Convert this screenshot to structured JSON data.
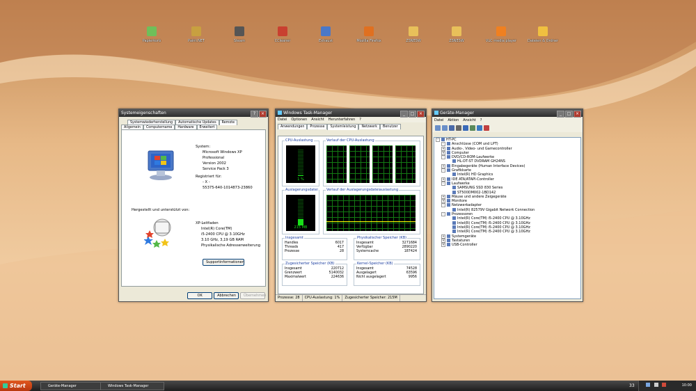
{
  "desktop_icons": [
    {
      "label": "Papierkorb",
      "icon": "recycle-bin-icon",
      "color": "#6fbf5a"
    },
    {
      "label": "Paint.NET",
      "icon": "paint-icon",
      "color": "#c8a040"
    },
    {
      "label": "Steam",
      "icon": "steam-icon",
      "color": "#555555"
    },
    {
      "label": "CCleaner",
      "icon": "ccleaner-icon",
      "color": "#c94030"
    },
    {
      "label": "Exhaust",
      "icon": "exhaust-icon",
      "color": "#4a78c8"
    },
    {
      "label": "Mozilla Firefox",
      "icon": "firefox-icon",
      "color": "#e07020"
    },
    {
      "label": "ZSNESW",
      "icon": "zsnes-icon",
      "color": "#e8c05a"
    },
    {
      "label": "ZSNESW",
      "icon": "zsnes-icon",
      "color": "#e8c05a"
    },
    {
      "label": "VLC media player",
      "icon": "vlc-icon",
      "color": "#f08020"
    },
    {
      "label": "Dateien & Ordner",
      "icon": "folder-icon",
      "color": "#f0c040"
    }
  ],
  "sysprops": {
    "title": "Systemeigenschaften",
    "tabs_top": [
      "Systemwiederherstellung",
      "Automatische Updates",
      "Remote"
    ],
    "tabs_bottom": [
      "Allgemein",
      "Computername",
      "Hardware",
      "Erweitert"
    ],
    "system_heading": "System:",
    "system_lines": [
      "Microsoft Windows XP",
      "Professional",
      "Version 2002",
      "Service Pack 3"
    ],
    "registered_heading": "Registriert für:",
    "registered_lines": [
      "- X -",
      "",
      "55375-640-1014873-23860"
    ],
    "manufacturer": "Hergestellt und unterstützt von:",
    "computer_heading": "XP-Leitfaden",
    "computer_lines": [
      "Intel(R) Core(TM)",
      "i5-2400 CPU @ 3.10GHz",
      "3.10 GHz, 3,19 GB RAM",
      "Physikalische Adresserweiterung"
    ],
    "support_button": "Supportinformationen",
    "buttons": {
      "ok": "OK",
      "cancel": "Abbrechen",
      "apply": "Übernehmen"
    }
  },
  "taskmgr": {
    "title": "Windows Task-Manager",
    "menu": [
      "Datei",
      "Optionen",
      "Ansicht",
      "Herunterfahren",
      "?"
    ],
    "tabs": [
      "Anwendungen",
      "Prozesse",
      "Systemleistung",
      "Netzwerk",
      "Benutzer"
    ],
    "cpu_usage_title": "CPU-Auslastung",
    "cpu_history_title": "Verlauf der CPU-Auslastung",
    "cpu_value": "1 %",
    "cpu_fraction": 0.01,
    "pf_usage_title": "Auslagerungsdatei",
    "pf_history_title": "Verlauf der Auslagerungsdateiauslastung",
    "pf_value": "215 MB",
    "pf_fraction": 0.25,
    "totals": {
      "title": "Insgesamt",
      "rows": [
        [
          "Handles",
          "6017"
        ],
        [
          "Threads",
          "417"
        ],
        [
          "Prozesse",
          "28"
        ]
      ]
    },
    "commit": {
      "title": "Zugesicherter Speicher (KB)",
      "rows": [
        [
          "Insgesamt",
          "220712"
        ],
        [
          "Grenzwert",
          "5140032"
        ],
        [
          "Maximalwert",
          "224636"
        ]
      ]
    },
    "physical": {
      "title": "Physikalischer Speicher (KB)",
      "rows": [
        [
          "Insgesamt",
          "3271684"
        ],
        [
          "Verfügbar",
          "2890220"
        ],
        [
          "Systemcache",
          "187424"
        ]
      ]
    },
    "kernel": {
      "title": "Kernel-Speicher (KB)",
      "rows": [
        [
          "Insgesamt",
          "74528"
        ],
        [
          "Ausgelagert",
          "63596"
        ],
        [
          "Nicht ausgelagert",
          "9956"
        ]
      ]
    },
    "status": [
      "Prozesse: 28",
      "CPU-Auslastung: 1%",
      "Zugesicherter Speicher: 215M"
    ]
  },
  "devmgr": {
    "title": "Geräte-Manager",
    "menu": [
      "Datei",
      "Aktion",
      "Ansicht",
      "?"
    ],
    "toolbar_icons": [
      "back-icon",
      "forward-icon",
      "properties-icon",
      "print-icon",
      "help-icon",
      "scan-icon",
      "update-driver-icon",
      "uninstall-icon"
    ],
    "tree": [
      {
        "level": 0,
        "expander": "-",
        "label": "HT-PC"
      },
      {
        "level": 1,
        "expander": "-",
        "label": "Anschlüsse (COM und LPT)"
      },
      {
        "level": 1,
        "expander": "+",
        "label": "Audio-, Video- und Gamecontroller"
      },
      {
        "level": 1,
        "expander": "+",
        "label": "Computer"
      },
      {
        "level": 1,
        "expander": "-",
        "label": "DVD/CD-ROM-Laufwerke"
      },
      {
        "level": 2,
        "expander": "",
        "label": "HL-DT-ST DVDRAM GH24NS"
      },
      {
        "level": 1,
        "expander": "+",
        "label": "Eingabegeräte (Human Interface Devices)"
      },
      {
        "level": 1,
        "expander": "-",
        "label": "Grafikkarte"
      },
      {
        "level": 2,
        "expander": "",
        "label": "Intel(R) HD Graphics"
      },
      {
        "level": 1,
        "expander": "+",
        "label": "IDE ATA/ATAPI-Controller"
      },
      {
        "level": 1,
        "expander": "-",
        "label": "Laufwerke"
      },
      {
        "level": 2,
        "expander": "",
        "label": "SAMSUNG SSD 830 Series"
      },
      {
        "level": 2,
        "expander": "",
        "label": "ST500DM002-1BD142"
      },
      {
        "level": 1,
        "expander": "+",
        "label": "Mäuse und andere Zeigegeräte"
      },
      {
        "level": 1,
        "expander": "+",
        "label": "Monitore"
      },
      {
        "level": 1,
        "expander": "-",
        "label": "Netzwerkadapter"
      },
      {
        "level": 2,
        "expander": "",
        "label": "Intel(R) 82579V Gigabit Network Connection"
      },
      {
        "level": 1,
        "expander": "-",
        "label": "Prozessoren"
      },
      {
        "level": 2,
        "expander": "",
        "label": "Intel(R) Core(TM) i5-2400 CPU @ 3.10GHz"
      },
      {
        "level": 2,
        "expander": "",
        "label": "Intel(R) Core(TM) i5-2400 CPU @ 3.10GHz"
      },
      {
        "level": 2,
        "expander": "",
        "label": "Intel(R) Core(TM) i5-2400 CPU @ 3.10GHz"
      },
      {
        "level": 2,
        "expander": "",
        "label": "Intel(R) Core(TM) i5-2400 CPU @ 3.10GHz"
      },
      {
        "level": 1,
        "expander": "+",
        "label": "Systemgeräte"
      },
      {
        "level": 1,
        "expander": "+",
        "label": "Tastaturen"
      },
      {
        "level": 1,
        "expander": "+",
        "label": "USB-Controller"
      }
    ]
  },
  "taskbar": {
    "start_label": "Start",
    "tasks": [
      "Geräte-Manager",
      "Windows Task-Manager"
    ],
    "clock": "10:00",
    "tray_number": "33"
  }
}
